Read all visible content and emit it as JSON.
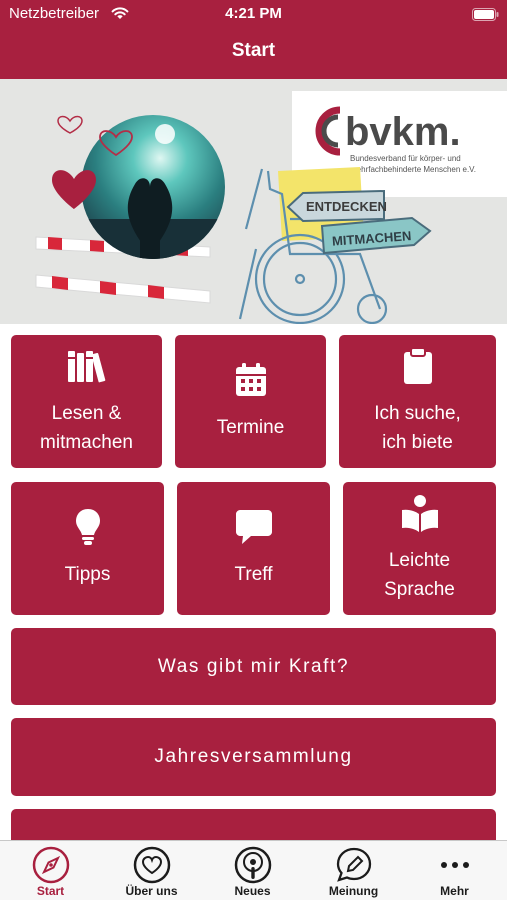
{
  "status_bar": {
    "carrier": "Netzbetreiber",
    "time": "4:21 PM"
  },
  "header": {
    "title": "Start"
  },
  "banner": {
    "logo_text": "bvkm.",
    "logo_subline_1": "Bundesverband für körper- und",
    "logo_subline_2": "mehrfachbehinderte Menschen e.V.",
    "sign_1": "ENTDECKEN",
    "sign_2": "MITMACHEN"
  },
  "tiles": [
    {
      "label_line1": "Lesen &",
      "label_line2": "mitmachen",
      "icon": "books-icon"
    },
    {
      "label_line1": "Termine",
      "label_line2": "",
      "icon": "calendar-icon"
    },
    {
      "label_line1": "Ich suche,",
      "label_line2": "ich biete",
      "icon": "clipboard-icon"
    },
    {
      "label_line1": "Tipps",
      "label_line2": "",
      "icon": "lightbulb-icon"
    },
    {
      "label_line1": "Treff",
      "label_line2": "",
      "icon": "chat-bubble-icon"
    },
    {
      "label_line1": "Leichte",
      "label_line2": "Sprache",
      "icon": "reader-icon"
    }
  ],
  "wide_buttons": [
    {
      "label": "Was gibt mir Kraft?"
    },
    {
      "label": "Jahresversammlung"
    }
  ],
  "tab_bar": {
    "items": [
      {
        "label": "Start",
        "icon": "compass-icon",
        "active": true
      },
      {
        "label": "Über uns",
        "icon": "heart-icon",
        "active": false
      },
      {
        "label": "Neues",
        "icon": "podcast-icon",
        "active": false
      },
      {
        "label": "Meinung",
        "icon": "pencil-chat-icon",
        "active": false
      },
      {
        "label": "Mehr",
        "icon": "more-dots-icon",
        "active": false
      }
    ]
  },
  "colors": {
    "brand": "#a8203f",
    "tab_bar_bg": "#f7f7f7",
    "banner_bg": "#e4e5e3"
  }
}
